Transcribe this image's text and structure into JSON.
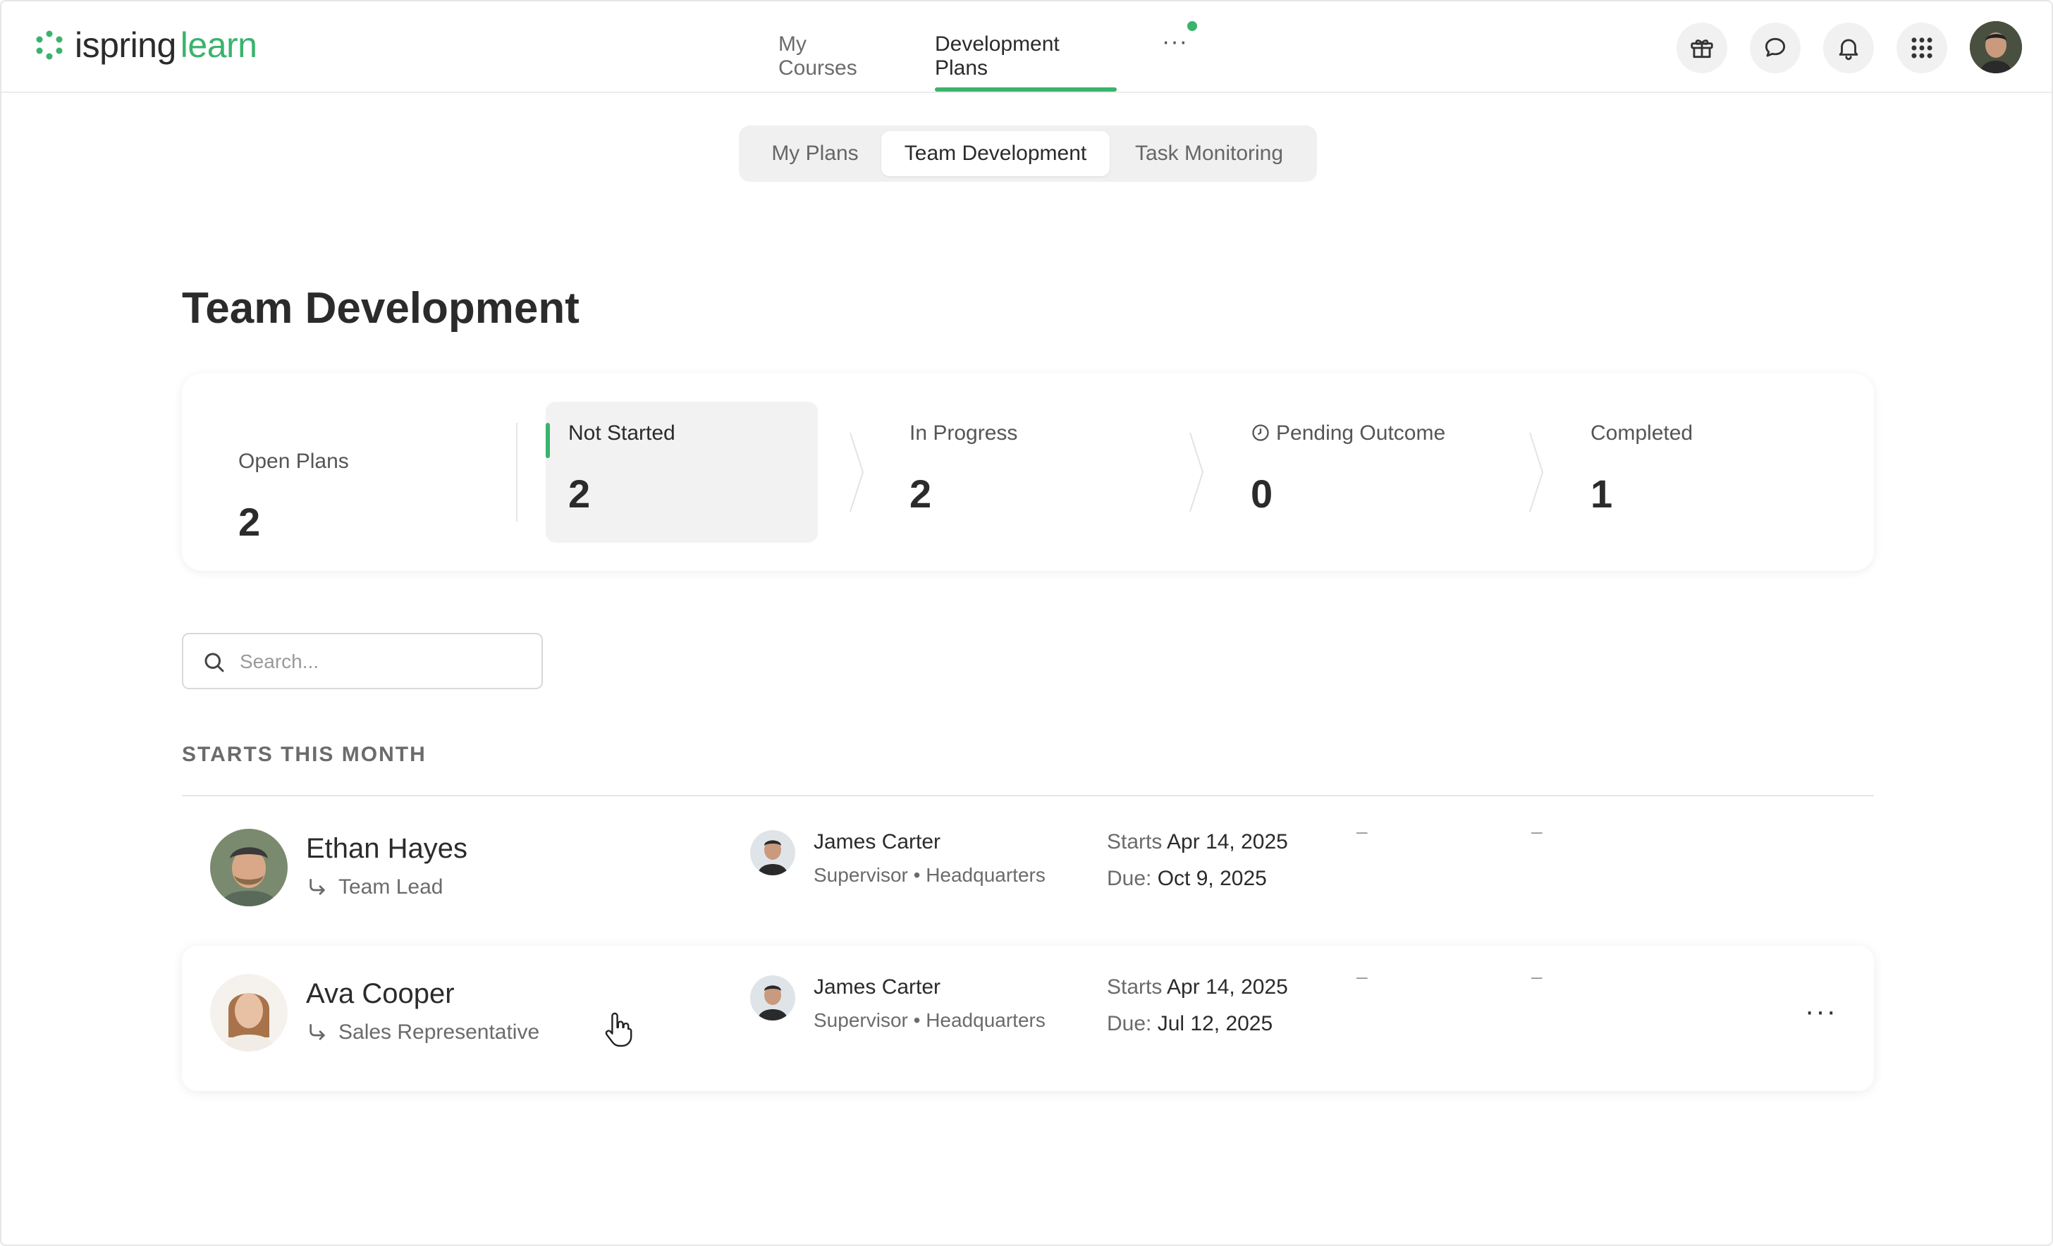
{
  "brand": {
    "part1": "ispring",
    "part2": "learn",
    "color": "#3ab36c"
  },
  "nav": {
    "my_courses": "My Courses",
    "development_plans": "Development Plans",
    "more": "···"
  },
  "tabs": {
    "my_plans": "My Plans",
    "team_development": "Team Development",
    "task_monitoring": "Task Monitoring"
  },
  "page": {
    "title": "Team Development"
  },
  "stats": {
    "open_plans": {
      "label": "Open Plans",
      "value": "2"
    },
    "not_started": {
      "label": "Not Started",
      "value": "2"
    },
    "in_progress": {
      "label": "In Progress",
      "value": "2"
    },
    "pending_outcome": {
      "label": "Pending Outcome",
      "value": "0"
    },
    "completed": {
      "label": "Completed",
      "value": "1"
    }
  },
  "search": {
    "placeholder": "Search..."
  },
  "section": {
    "title": "STARTS THIS MONTH"
  },
  "rows": [
    {
      "name": "Ethan Hayes",
      "role": "Team Lead",
      "supervisor": "James Carter",
      "supervisor_meta": "Supervisor • Headquarters",
      "starts_label": "Starts",
      "starts": "Apr 14, 2025",
      "due_label": "Due:",
      "due": "Oct 9, 2025",
      "col1": "–",
      "col2": "–"
    },
    {
      "name": "Ava Cooper",
      "role": "Sales Representative",
      "supervisor": "James Carter",
      "supervisor_meta": "Supervisor • Headquarters",
      "starts_label": "Starts",
      "starts": "Apr 14, 2025",
      "due_label": "Due:",
      "due": "Jul 12, 2025",
      "col1": "–",
      "col2": "–",
      "more": "···"
    }
  ],
  "icons": {
    "gift": "gift-icon",
    "chat": "chat-icon",
    "bell": "bell-icon",
    "apps": "apps-grid-icon",
    "search": "search-icon",
    "clock": "clock-icon",
    "reply_arrow": "reply-arrow-icon"
  }
}
